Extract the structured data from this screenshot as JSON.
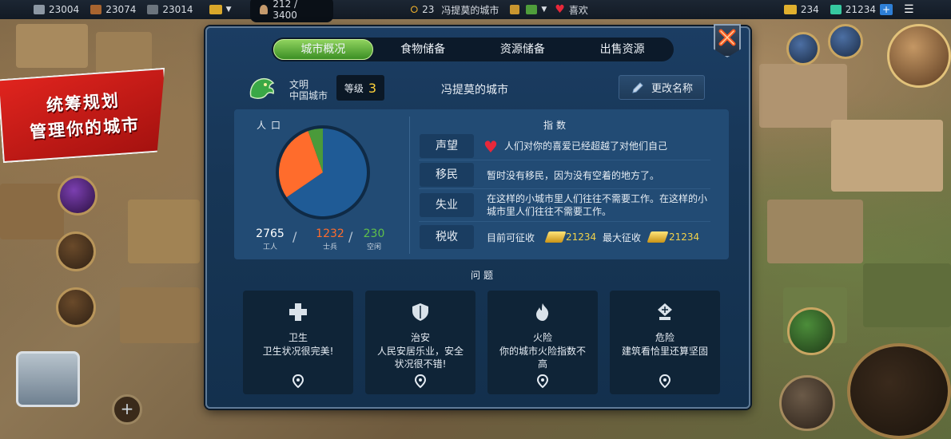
{
  "topbar": {
    "res1": "23004",
    "res2": "23074",
    "res3": "23014",
    "population": "212 / 3400",
    "city_level": "23",
    "city_label": "冯提莫的城市",
    "mood": "喜欢",
    "gold": "234",
    "gems": "21234"
  },
  "banner": {
    "line1": "统筹规划",
    "line2": "管理你的城市"
  },
  "tabs": [
    {
      "label": "城市概况",
      "active": true
    },
    {
      "label": "食物储备",
      "active": false
    },
    {
      "label": "资源储备",
      "active": false
    },
    {
      "label": "出售资源",
      "active": false
    }
  ],
  "civ": {
    "label": "文明",
    "name": "中国城市",
    "level_label": "等级",
    "level": "3",
    "city_name": "冯提莫的城市",
    "rename_label": "更改名称"
  },
  "population": {
    "title": "人口",
    "workers": "2765",
    "workers_label": "工人",
    "soldiers": "1232",
    "soldiers_label": "士兵",
    "idle": "230",
    "idle_label": "空闲"
  },
  "chart_data": {
    "type": "pie",
    "categories": [
      "工人",
      "士兵",
      "空闲"
    ],
    "values": [
      2765,
      1232,
      230
    ],
    "colors": [
      "#1f5b96",
      "#ff6c2c",
      "#4a9a3a"
    ]
  },
  "indices": {
    "title": "指数",
    "rows": [
      {
        "label": "声望",
        "text": "人们对你的喜爱已经超越了对他们自己"
      },
      {
        "label": "移民",
        "text": "暂时没有移民，因为没有空着的地方了。"
      },
      {
        "label": "失业",
        "text": "在这样的小城市里人们往往不需要工作。在这样的小城市里人们往往不需要工作。"
      },
      {
        "label": "税收",
        "current_label": "目前可征收",
        "current": "21234",
        "max_label": "最大征收",
        "max": "21234"
      }
    ]
  },
  "issues": {
    "title": "问题",
    "cards": [
      {
        "title": "卫生",
        "desc": "卫生状况很完美!"
      },
      {
        "title": "治安",
        "desc": "人民安居乐业，安全状况很不错!"
      },
      {
        "title": "火险",
        "desc": "你的城市火险指数不高"
      },
      {
        "title": "危险",
        "desc": "建筑看恰里还算坚固"
      }
    ]
  },
  "colors": {
    "tab_active": "#5cb53a",
    "gold_text": "#f2d24a",
    "soldiers": "#ff6c2c",
    "idle": "#4a9a3a",
    "workers": "#1f5b96"
  }
}
